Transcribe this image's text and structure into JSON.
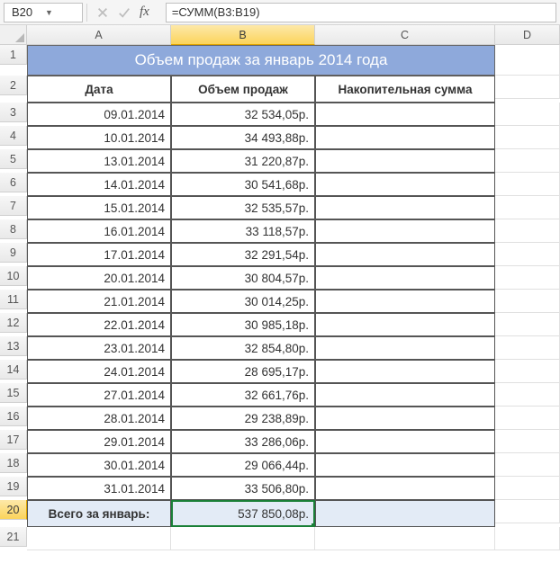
{
  "namebox": "B20",
  "formula": "=СУММ(B3:B19)",
  "columns": [
    "A",
    "B",
    "C",
    "D"
  ],
  "active_col": "B",
  "active_row": "20",
  "row_headers": [
    "1",
    "2",
    "3",
    "4",
    "5",
    "6",
    "7",
    "8",
    "9",
    "10",
    "11",
    "12",
    "13",
    "14",
    "15",
    "16",
    "17",
    "18",
    "19",
    "20",
    "21"
  ],
  "title": "Объем продаж за январь 2014 года",
  "headers": {
    "date": "Дата",
    "volume": "Объем продаж",
    "cum": "Накопительная сумма"
  },
  "rows": [
    {
      "date": "09.01.2014",
      "vol": "32 534,05р."
    },
    {
      "date": "10.01.2014",
      "vol": "34 493,88р."
    },
    {
      "date": "13.01.2014",
      "vol": "31 220,87р."
    },
    {
      "date": "14.01.2014",
      "vol": "30 541,68р."
    },
    {
      "date": "15.01.2014",
      "vol": "32 535,57р."
    },
    {
      "date": "16.01.2014",
      "vol": "33 118,57р."
    },
    {
      "date": "17.01.2014",
      "vol": "32 291,54р."
    },
    {
      "date": "20.01.2014",
      "vol": "30 804,57р."
    },
    {
      "date": "21.01.2014",
      "vol": "30 014,25р."
    },
    {
      "date": "22.01.2014",
      "vol": "30 985,18р."
    },
    {
      "date": "23.01.2014",
      "vol": "32 854,80р."
    },
    {
      "date": "24.01.2014",
      "vol": "28 695,17р."
    },
    {
      "date": "27.01.2014",
      "vol": "32 661,76р."
    },
    {
      "date": "28.01.2014",
      "vol": "29 238,89р."
    },
    {
      "date": "29.01.2014",
      "vol": "33 286,06р."
    },
    {
      "date": "30.01.2014",
      "vol": "29 066,44р."
    },
    {
      "date": "31.01.2014",
      "vol": "33 506,80р."
    }
  ],
  "total": {
    "label": "Всего за январь:",
    "value": "537 850,08р."
  }
}
